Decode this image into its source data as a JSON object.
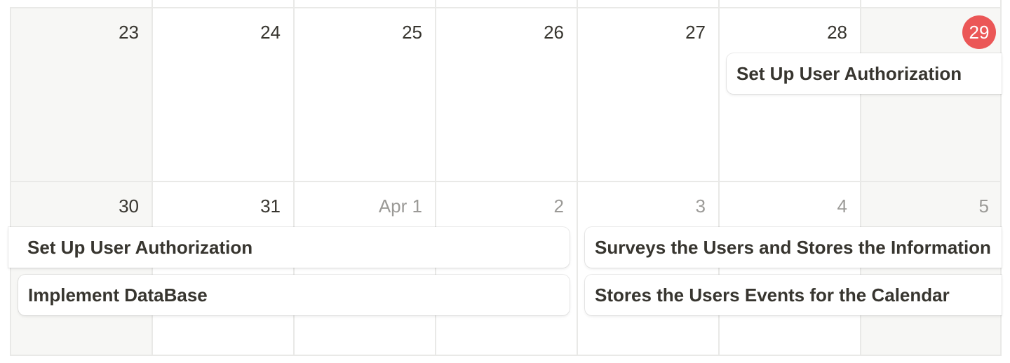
{
  "week1": {
    "days": [
      {
        "label": "23",
        "muted": false,
        "today": false,
        "weekend": true
      },
      {
        "label": "24",
        "muted": false,
        "today": false,
        "weekend": false
      },
      {
        "label": "25",
        "muted": false,
        "today": false,
        "weekend": false
      },
      {
        "label": "26",
        "muted": false,
        "today": false,
        "weekend": false
      },
      {
        "label": "27",
        "muted": false,
        "today": false,
        "weekend": false
      },
      {
        "label": "28",
        "muted": false,
        "today": false,
        "weekend": false
      },
      {
        "label": "29",
        "muted": false,
        "today": true,
        "weekend": true
      }
    ],
    "events": [
      {
        "title": "Set Up User Authorization"
      }
    ]
  },
  "week2": {
    "days": [
      {
        "label": "30",
        "muted": false,
        "weekend": true
      },
      {
        "label": "31",
        "muted": false,
        "weekend": false
      },
      {
        "label": "Apr 1",
        "muted": true,
        "weekend": false
      },
      {
        "label": "2",
        "muted": true,
        "weekend": false
      },
      {
        "label": "3",
        "muted": true,
        "weekend": false
      },
      {
        "label": "4",
        "muted": true,
        "weekend": false
      },
      {
        "label": "5",
        "muted": true,
        "weekend": true
      }
    ],
    "events": [
      {
        "title": "Set Up User Authorization"
      },
      {
        "title": "Implement DataBase"
      },
      {
        "title": "Surveys the Users and Stores the Information"
      },
      {
        "title": "Stores the Users Events for the Calendar"
      }
    ]
  },
  "colors": {
    "today_badge": "#eb5757",
    "grid_line": "#e9e9e7",
    "weekend_bg": "#f7f7f5",
    "text": "#37352f",
    "muted_text": "#9b9a97"
  }
}
